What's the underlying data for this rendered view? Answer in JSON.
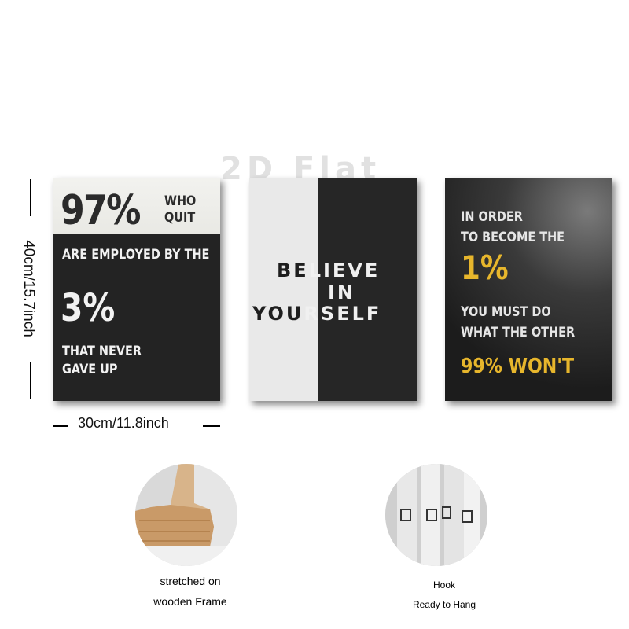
{
  "watermark": "2D Flat",
  "dimensions": {
    "height_label": "40cm/15.7inch",
    "width_label": "30cm/11.8inch"
  },
  "panel_left": {
    "big_percent": "97%",
    "who_quit": [
      "WHO",
      "QUIT"
    ],
    "employed_line": "ARE EMPLOYED BY THE",
    "small_percent": "3%",
    "never_gave_up": [
      "THAT NEVER",
      "GAVE UP"
    ]
  },
  "panel_middle": {
    "line1_dark": "BE",
    "line1_light": "LIEVE",
    "line2_light": "IN",
    "line3_dark": "YOU",
    "line3_light": "RSELF"
  },
  "panel_right": {
    "line1": "IN ORDER",
    "line2": "TO BECOME THE",
    "highlight_1": "1%",
    "line3": "YOU MUST DO",
    "line4": "WHAT THE OTHER",
    "highlight_2": "99% WON'T",
    "accent_color": "#e7b62c"
  },
  "details": {
    "frame_caption": [
      "stretched on",
      "wooden Frame"
    ],
    "hook_caption": [
      "Hook",
      "Ready to Hang"
    ]
  }
}
